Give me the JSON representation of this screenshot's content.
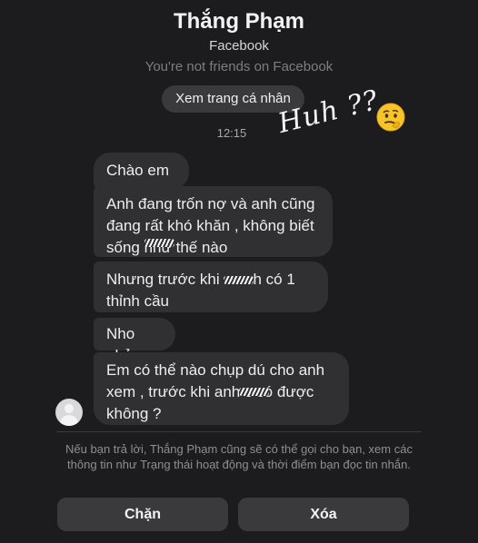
{
  "header": {
    "contact_name": "Thắng Phạm",
    "source": "Facebook",
    "friend_status": "You're not friends on Facebook",
    "view_profile_label": "Xem trang cá nhân"
  },
  "conversation": {
    "timestamp": "12:15",
    "messages": [
      "Chào em .",
      "Anh đang trốn nợ và anh cũng\nđang rất khó khăn , không biết\nsống        như thế nào",
      "Nhưng trước khi c       anh có 1\nthỉnh cầu",
      "Nho nhỏ",
      "Em có thể nào chụp dú cho anh\nxem , trước khi anh c      có được\nkhông ?"
    ]
  },
  "footer": {
    "notice": "Nếu bạn trả lời, Thắng Phạm cũng sẽ có thể gọi cho bạn, xem các thông tin như Trạng thái hoạt động và thời điểm bạn đọc tin nhắn.",
    "block_label": "Chặn",
    "delete_label": "Xóa"
  },
  "overlay": {
    "handwritten_text": "Huh ??",
    "emoji": "thinking-face-emoji"
  },
  "colors": {
    "background": "#1c1c1e",
    "bubble": "#303032",
    "button": "#3a3a3c",
    "muted_text": "#8e8e93"
  }
}
